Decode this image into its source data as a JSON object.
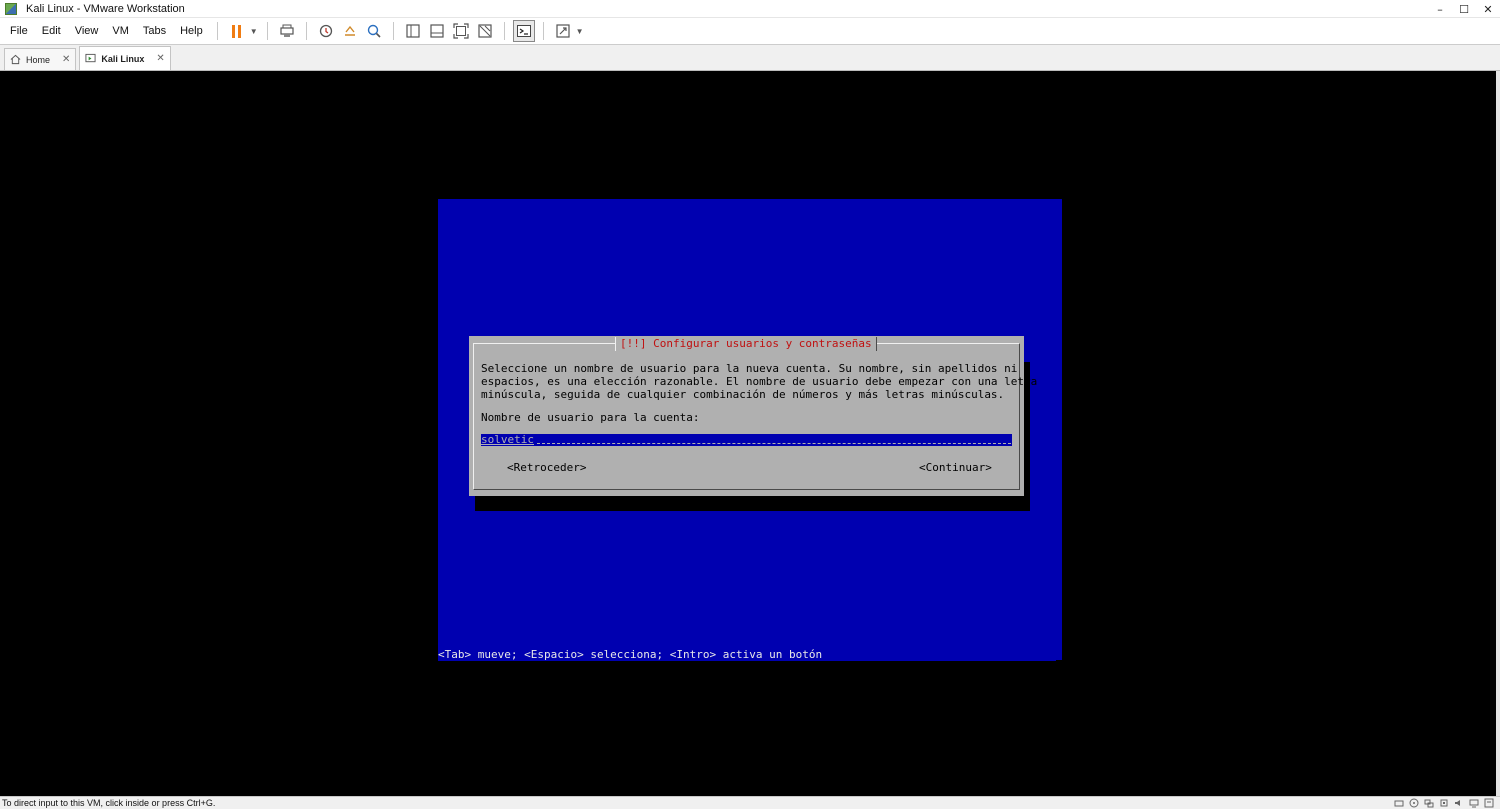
{
  "window": {
    "title": "Kali Linux - VMware Workstation",
    "controls": {
      "minimize": "–",
      "maximize": "☐",
      "close": "✕"
    }
  },
  "menu": [
    "File",
    "Edit",
    "View",
    "VM",
    "Tabs",
    "Help"
  ],
  "toolbar": {
    "icons": [
      "pause-icon",
      "send-ctrl-alt-del-icon",
      "snapshot-take-icon",
      "snapshot-revert-icon",
      "snapshot-manager-icon",
      "library-view-icon",
      "thumbnail-view-icon",
      "fullscreen-icon",
      "unity-icon",
      "console-view-icon",
      "stretch-guest-icon"
    ],
    "accent": "#f07c12"
  },
  "tabs": [
    {
      "label": "Home",
      "active": false,
      "icon": "home-icon"
    },
    {
      "label": "Kali Linux",
      "active": true,
      "icon": "vm-icon"
    }
  ],
  "installer": {
    "screen_color": "#0000b0",
    "dialog_color": "#b0b0b0",
    "title_color": "#c01010",
    "title": "[!!] Configurar usuarios y contraseñas",
    "description": "Seleccione un nombre de usuario para la nueva cuenta. Su nombre, sin apellidos ni\nespacios, es una elección razonable. El nombre de usuario debe empezar con una letra\nminúscula, seguida de cualquier combinación de números y más letras minúsculas.",
    "field_label": "Nombre de usuario para la cuenta:",
    "field_value": "solvetic",
    "back_button": "<Retroceder>",
    "continue_button": "<Continuar>",
    "hint": "<Tab> mueve; <Espacio> selecciona; <Intro> activa un botón"
  },
  "status": {
    "message": "To direct input to this VM, click inside or press Ctrl+G.",
    "icons": [
      "hard-disk-icon",
      "cd-icon",
      "network-icon",
      "usb-icon",
      "sound-icon",
      "display-icon",
      "message-icon"
    ]
  }
}
